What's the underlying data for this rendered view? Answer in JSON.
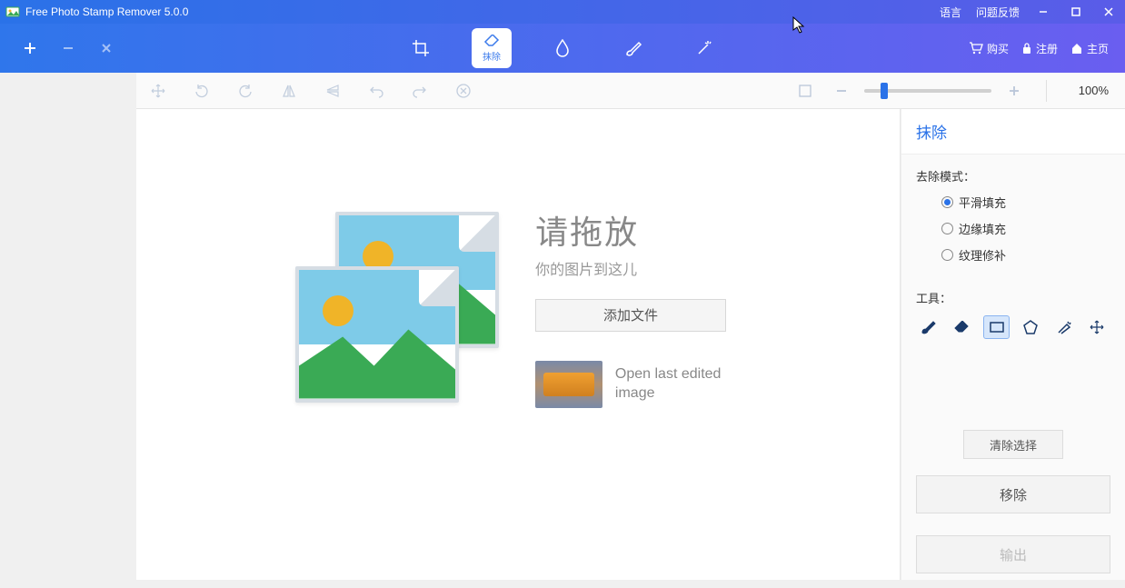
{
  "titlebar": {
    "title": "Free Photo Stamp Remover 5.0.0",
    "language": "语言",
    "feedback": "问题反馈"
  },
  "maintoolbar": {
    "tools": {
      "crop": "裁剪",
      "erase": "抹除",
      "droplet": "水滴",
      "brush": "画笔",
      "pin": "固定"
    },
    "active_tool_label": "抹除",
    "buy": "购买",
    "register": "注册",
    "home": "主页"
  },
  "zoom": {
    "value": "100%"
  },
  "dropzone": {
    "title": "请拖放",
    "subtitle": "你的图片到这儿",
    "add_file": "添加文件",
    "open_last": "Open last edited image"
  },
  "sidepanel": {
    "header": "抹除",
    "remove_mode_label": "去除模式：",
    "modes": {
      "smooth": "平滑填充",
      "edge": "边缘填充",
      "texture": "纹理修补"
    },
    "tools_label": "工具：",
    "clear_selection": "清除选择",
    "remove": "移除",
    "output": "输出"
  }
}
